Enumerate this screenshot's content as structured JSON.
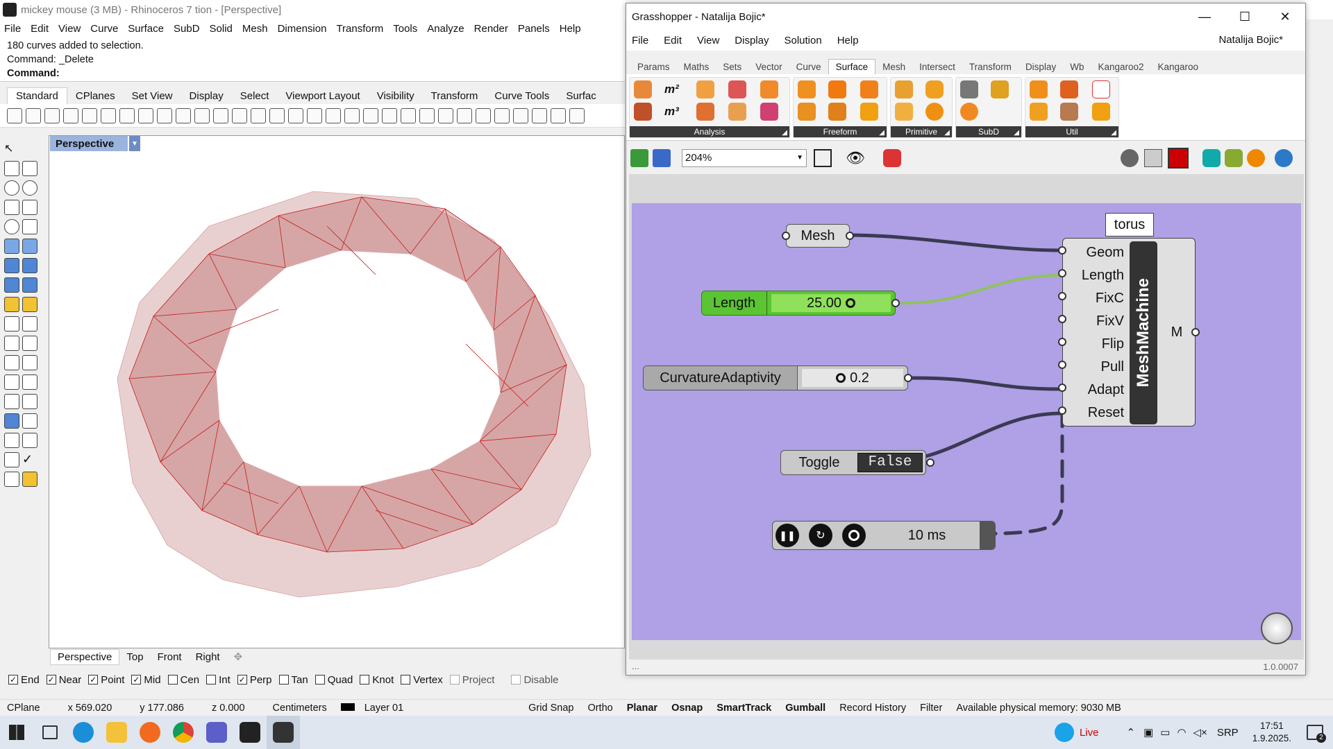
{
  "rhino": {
    "title": "mickey mouse (3 MB) - Rhinoceros 7 tion - [Perspective]",
    "menu": [
      "File",
      "Edit",
      "View",
      "Curve",
      "Surface",
      "SubD",
      "Solid",
      "Mesh",
      "Dimension",
      "Transform",
      "Tools",
      "Analyze",
      "Render",
      "Panels",
      "Help"
    ],
    "history_line": "180 curves added to selection.",
    "last_command": "Command: _Delete",
    "prompt": "Command:",
    "toolbar_tabs": [
      "Standard",
      "CPlanes",
      "Set View",
      "Display",
      "Select",
      "Viewport Layout",
      "Visibility",
      "Transform",
      "Curve Tools",
      "Surfac"
    ],
    "viewport_title": "Perspective",
    "viewport_tabs": [
      "Perspective",
      "Top",
      "Front",
      "Right"
    ],
    "osnap": [
      {
        "label": "End",
        "checked": "✓"
      },
      {
        "label": "Near",
        "checked": "✓"
      },
      {
        "label": "Point",
        "checked": "✓"
      },
      {
        "label": "Mid",
        "checked": "✓"
      },
      {
        "label": "Cen",
        "checked": ""
      },
      {
        "label": "Int",
        "checked": ""
      },
      {
        "label": "Perp",
        "checked": "✓"
      },
      {
        "label": "Tan",
        "checked": ""
      },
      {
        "label": "Quad",
        "checked": ""
      },
      {
        "label": "Knot",
        "checked": ""
      },
      {
        "label": "Vertex",
        "checked": ""
      },
      {
        "label": "Project",
        "checked": ""
      },
      {
        "label": "Disable",
        "checked": ""
      }
    ],
    "status": {
      "cplane": "CPlane",
      "x": "x 569.020",
      "y": "y 177.086",
      "z": "z 0.000",
      "units": "Centimeters",
      "layer": "Layer 01",
      "grid_snap": "Grid Snap",
      "ortho": "Ortho",
      "planar": "Planar",
      "osnap": "Osnap",
      "smarttrack": "SmartTrack",
      "gumball": "Gumball",
      "record_history": "Record History",
      "filter": "Filter",
      "memory": "Available physical memory: 9030 MB"
    }
  },
  "grasshopper": {
    "title": "Grasshopper - Natalija Bojic*",
    "menu": [
      "File",
      "Edit",
      "View",
      "Display",
      "Solution",
      "Help"
    ],
    "user": "Natalija Bojic*",
    "tabs": [
      "Params",
      "Maths",
      "Sets",
      "Vector",
      "Curve",
      "Surface",
      "Mesh",
      "Intersect",
      "Transform",
      "Display",
      "Wb",
      "Kangaroo2",
      "Kangaroo"
    ],
    "active_tab": "Surface",
    "ribbon_groups": [
      "Analysis",
      "Freeform",
      "Primitive",
      "SubD",
      "Util"
    ],
    "zoom": "204%",
    "version": "1.0.0007",
    "footer_dots": "...",
    "nodes": {
      "mesh": "Mesh",
      "length_label": "Length",
      "length_value": "25.00",
      "curv_label": "CurvatureAdaptivity",
      "curv_value": "0.2",
      "toggle_label": "Toggle",
      "toggle_value": "False",
      "timer_value": "10 ms",
      "torus_tag": "torus",
      "meshmachine_title": "MeshMachine",
      "meshmachine_output": "M",
      "meshmachine_inputs": [
        "Geom",
        "Length",
        "FixC",
        "FixV",
        "Flip",
        "Pull",
        "Adapt",
        "Reset"
      ]
    }
  },
  "taskbar": {
    "live": "Live",
    "lang": "SRP",
    "time": "17:51",
    "date": "1.9.2025.",
    "notif_count": "2"
  }
}
